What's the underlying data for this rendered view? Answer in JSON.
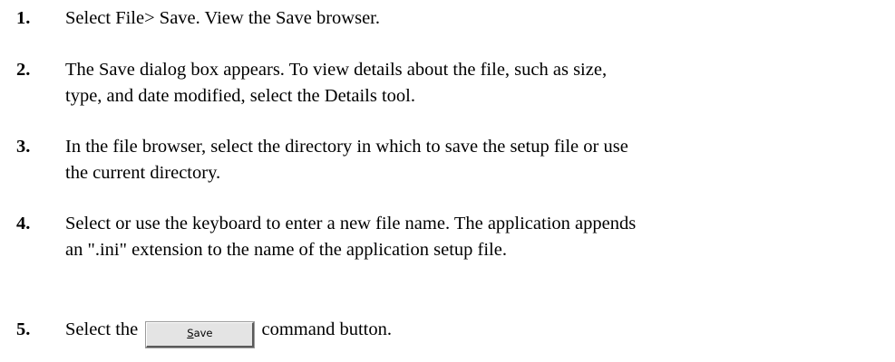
{
  "steps": [
    {
      "number": "1.",
      "text": "Select File> Save. View the Save browser."
    },
    {
      "number": "2.",
      "line1": "The Save dialog box appears. To view details about the file, such as size,",
      "line2": "type, and date modified, select the Details tool."
    },
    {
      "number": "3.",
      "line1": "In the file browser, select the directory in which to save the setup file or use",
      "line2": "the current directory."
    },
    {
      "number": "4.",
      "line1": "Select or use the keyboard to enter a new file name. The application appends",
      "line2": "an \".ini\" extension to the name of the application setup file."
    },
    {
      "number": "5.",
      "before": "Select the",
      "button": {
        "accel": "S",
        "rest": "ave"
      },
      "after": "command button."
    }
  ]
}
